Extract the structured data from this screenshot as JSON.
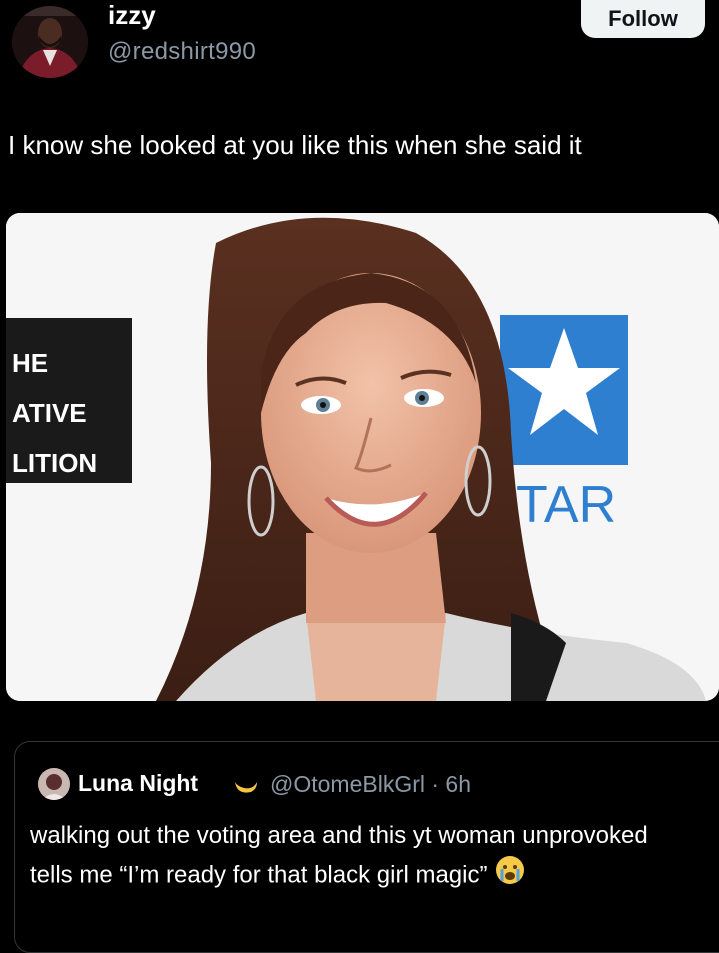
{
  "author": {
    "display_name": "izzy",
    "handle": "@redshirt990",
    "avatar_icon": "profile-avatar"
  },
  "follow_label": "Follow",
  "tweet": {
    "text": "I know she looked at you like this when she said it"
  },
  "photo": {
    "backdrop_left_text": [
      "HE",
      "ATIVE",
      "LITION"
    ],
    "backdrop_right_text": "TAR",
    "star_icon": "star-logo",
    "accent_blue": "#2e7fd0"
  },
  "quoted": {
    "display_name": "Luna Night",
    "name_emoji": "crescent-moon-icon",
    "handle_time": "@OtomeBlkGrl · 6h",
    "text": "walking out the voting area and this yt woman unprovoked tells me “I’m ready for that black girl magic”",
    "end_emoji": "crying-face-icon"
  },
  "colors": {
    "background": "#000000",
    "muted_text": "#8b98a5",
    "border": "#333639",
    "follow_bg": "#eff3f4"
  }
}
